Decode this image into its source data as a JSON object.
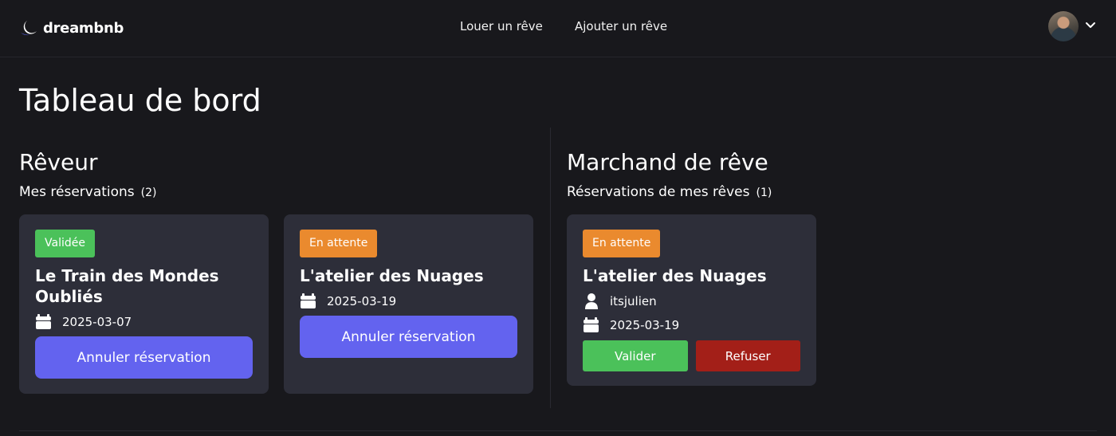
{
  "header": {
    "brand": "dreambnb",
    "nav": [
      "Louer un rêve",
      "Ajouter un rêve"
    ]
  },
  "page_title": "Tableau de bord",
  "dreamer": {
    "title": "Rêveur",
    "subtitle": "Mes réservations",
    "count": "(2)",
    "bookings": [
      {
        "status": "Validée",
        "status_color": "#4bc15a",
        "title": "Le Train des Mondes Oubliés",
        "date": "2025-03-07",
        "action": "Annuler réservation"
      },
      {
        "status": "En attente",
        "status_color": "#ea8a2e",
        "title": "L'atelier des Nuages",
        "date": "2025-03-19",
        "action": "Annuler réservation"
      }
    ]
  },
  "merchant": {
    "title": "Marchand de rêve",
    "subtitle": "Réservations de mes rêves",
    "count": "(1)",
    "bookings": [
      {
        "status": "En attente",
        "status_color": "#ea8a2e",
        "title": "L'atelier des Nuages",
        "user": "itsjulien",
        "date": "2025-03-19",
        "accept": "Valider",
        "refuse": "Refuser"
      }
    ]
  },
  "colors": {
    "background": "#18181c",
    "card": "#2d2e39",
    "primary": "#6363ef",
    "success": "#4bc15a",
    "danger": "#a31f18"
  },
  "icons": [
    "moon-logo-icon",
    "calendar-icon",
    "user-icon",
    "chevron-down-icon"
  ]
}
